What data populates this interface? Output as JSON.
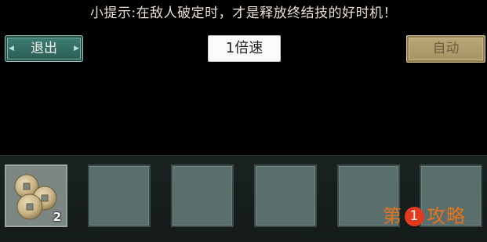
{
  "hint": {
    "text": "小提示:在敌人破定时，才是释放终结技的好时机！"
  },
  "controls": {
    "exit_label": "退出",
    "speed_label": "1倍速",
    "auto_label": "自动"
  },
  "inventory": {
    "slots": [
      {
        "icon": "copper-coins-icon",
        "count": "2"
      },
      {
        "icon": ""
      },
      {
        "icon": ""
      },
      {
        "icon": ""
      },
      {
        "icon": ""
      },
      {
        "icon": ""
      }
    ]
  },
  "watermark": {
    "prefix": "第",
    "number": "1",
    "suffix": "攻略"
  },
  "colors": {
    "exit_button": "#3f7e73",
    "auto_button": "#b9a878",
    "slot_bg": "#5a6f6c",
    "watermark": "#e3731f"
  }
}
